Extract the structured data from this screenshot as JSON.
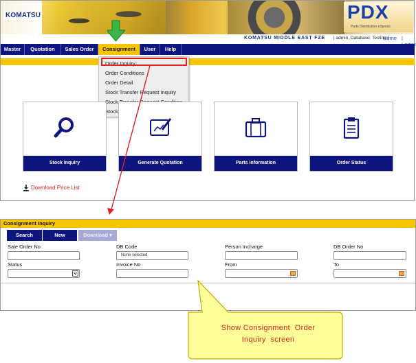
{
  "header": {
    "logo_text": "KOMATSU",
    "product_name": "PDX",
    "product_subtitle": "Parts Distribution eXpress",
    "company": "KOMATSU MIDDLE EAST FZE",
    "user_info": "| admin, Database: Testing |",
    "home_link": "Home",
    "logout_link": "| Logout"
  },
  "nav": {
    "items": [
      "Master",
      "Quotation",
      "Sales Order",
      "Consignment",
      "User",
      "Help"
    ],
    "active": "Consignment"
  },
  "dropdown": {
    "items": [
      "Order Inquiry",
      "Order Conditions",
      "Order Detail",
      "Stock Transfer Request Inquiry",
      "Stock Transfer Request Condition",
      "Stock Transfer Request Detail"
    ],
    "highlighted": "Order Inquiry"
  },
  "cards": [
    {
      "label": "Stock Inquiry",
      "icon": "magnifier-icon"
    },
    {
      "label": "Generate Quotation",
      "icon": "drawing-tablet-icon"
    },
    {
      "label": "Parts Information",
      "icon": "briefcase-icon"
    },
    {
      "label": "Order Status",
      "icon": "clipboard-icon"
    }
  ],
  "download_price_list": "Download Price List",
  "consignment_inquiry": {
    "title": "Consignment Inquiry",
    "buttons": {
      "search": "Search",
      "new": "New",
      "download": "Download ▾"
    },
    "fields": {
      "sale_order_no": {
        "label": "Sale Order No",
        "value": ""
      },
      "db_code": {
        "label": "DB Code",
        "value": "None selected"
      },
      "person_incharge": {
        "label": "Person Incharge",
        "value": ""
      },
      "db_order_no": {
        "label": "DB Order No",
        "value": ""
      },
      "status": {
        "label": "Status",
        "value": ""
      },
      "invoice_no": {
        "label": "Invoice No",
        "value": ""
      },
      "from": {
        "label": "From",
        "value": ""
      },
      "to": {
        "label": "To",
        "value": ""
      }
    }
  },
  "callout": {
    "line1": "Show Consignment  Order",
    "line2": "Inquiry  screen"
  },
  "colors": {
    "nav_bg": "#0f157e",
    "accent_yellow": "#f7c600",
    "callout_fill": "#ffff99",
    "annotation_red": "#e02020"
  }
}
